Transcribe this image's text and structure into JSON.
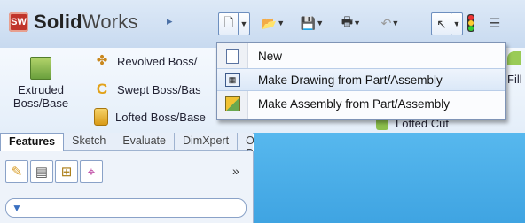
{
  "brand": {
    "name_bold": "Solid",
    "name_rest": "Works",
    "logo_text": "SW"
  },
  "ribbon": {
    "extruded_label": "Extruded Boss/Base",
    "revolved_label": "Revolved Boss/",
    "swept_label": "Swept Boss/Bas",
    "lofted_label": "Lofted Boss/Base",
    "lofted_cut_label": "Lofted Cut",
    "fillet_label": "Fill"
  },
  "tabs": [
    {
      "label": "Features"
    },
    {
      "label": "Sketch"
    },
    {
      "label": "Evaluate"
    },
    {
      "label": "DimXpert"
    },
    {
      "label": "Office Products"
    }
  ],
  "panel": {
    "more_label": "»"
  },
  "menu": {
    "items": [
      {
        "label": "New"
      },
      {
        "label": "Make Drawing from Part/Assembly"
      },
      {
        "label": "Make Assembly from Part/Assembly"
      }
    ]
  }
}
